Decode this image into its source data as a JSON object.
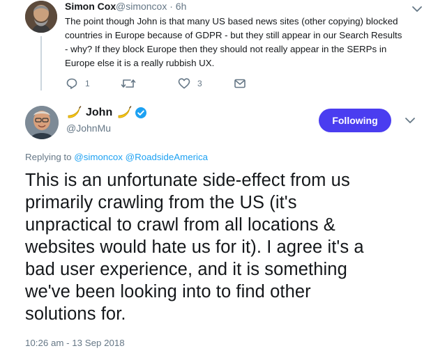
{
  "parent_tweet": {
    "name": "Simon Cox",
    "handle_time": "@simoncox · 6h",
    "lines": [
      "The point though John is that many US based news sites (other copying) blocked",
      "countries in Europe because of GDPR - but they still appear in our Search Results",
      "- why? If they block Europe then they should not really appear in the SERPs in",
      "Europe else it is a really rubbish UX."
    ],
    "reply_count": "1",
    "retweet_count": "",
    "like_count": "3"
  },
  "main_tweet": {
    "name": "John",
    "handle": "@JohnMu",
    "follow_label": "Following",
    "replying_prefix": "Replying to",
    "mention_1": "@simoncox",
    "mention_2": "@RoadsideAmerica",
    "lines": [
      "This is an unfortunate side-effect from us",
      "primarily crawling from the US (it's",
      "unpractical to crawl from all locations &",
      "websites would hate us for it). I agree it's a",
      "bad user experience, and it is something",
      "we've been looking into to find other",
      "solutions for."
    ],
    "timestamp": "10:26 am - 13 Sep 2018"
  },
  "icons": {
    "reply": "reply-icon",
    "retweet": "retweet-icon",
    "like": "heart-icon",
    "dm": "envelope-icon",
    "verified": "verified-badge-icon",
    "name_emoji": "banana-icon",
    "more": "chevron-down-icon"
  },
  "colors": {
    "follow_button": "#4a3df0",
    "link": "#1da1f2",
    "verified": "#1da1f2",
    "muted": "#657786"
  }
}
